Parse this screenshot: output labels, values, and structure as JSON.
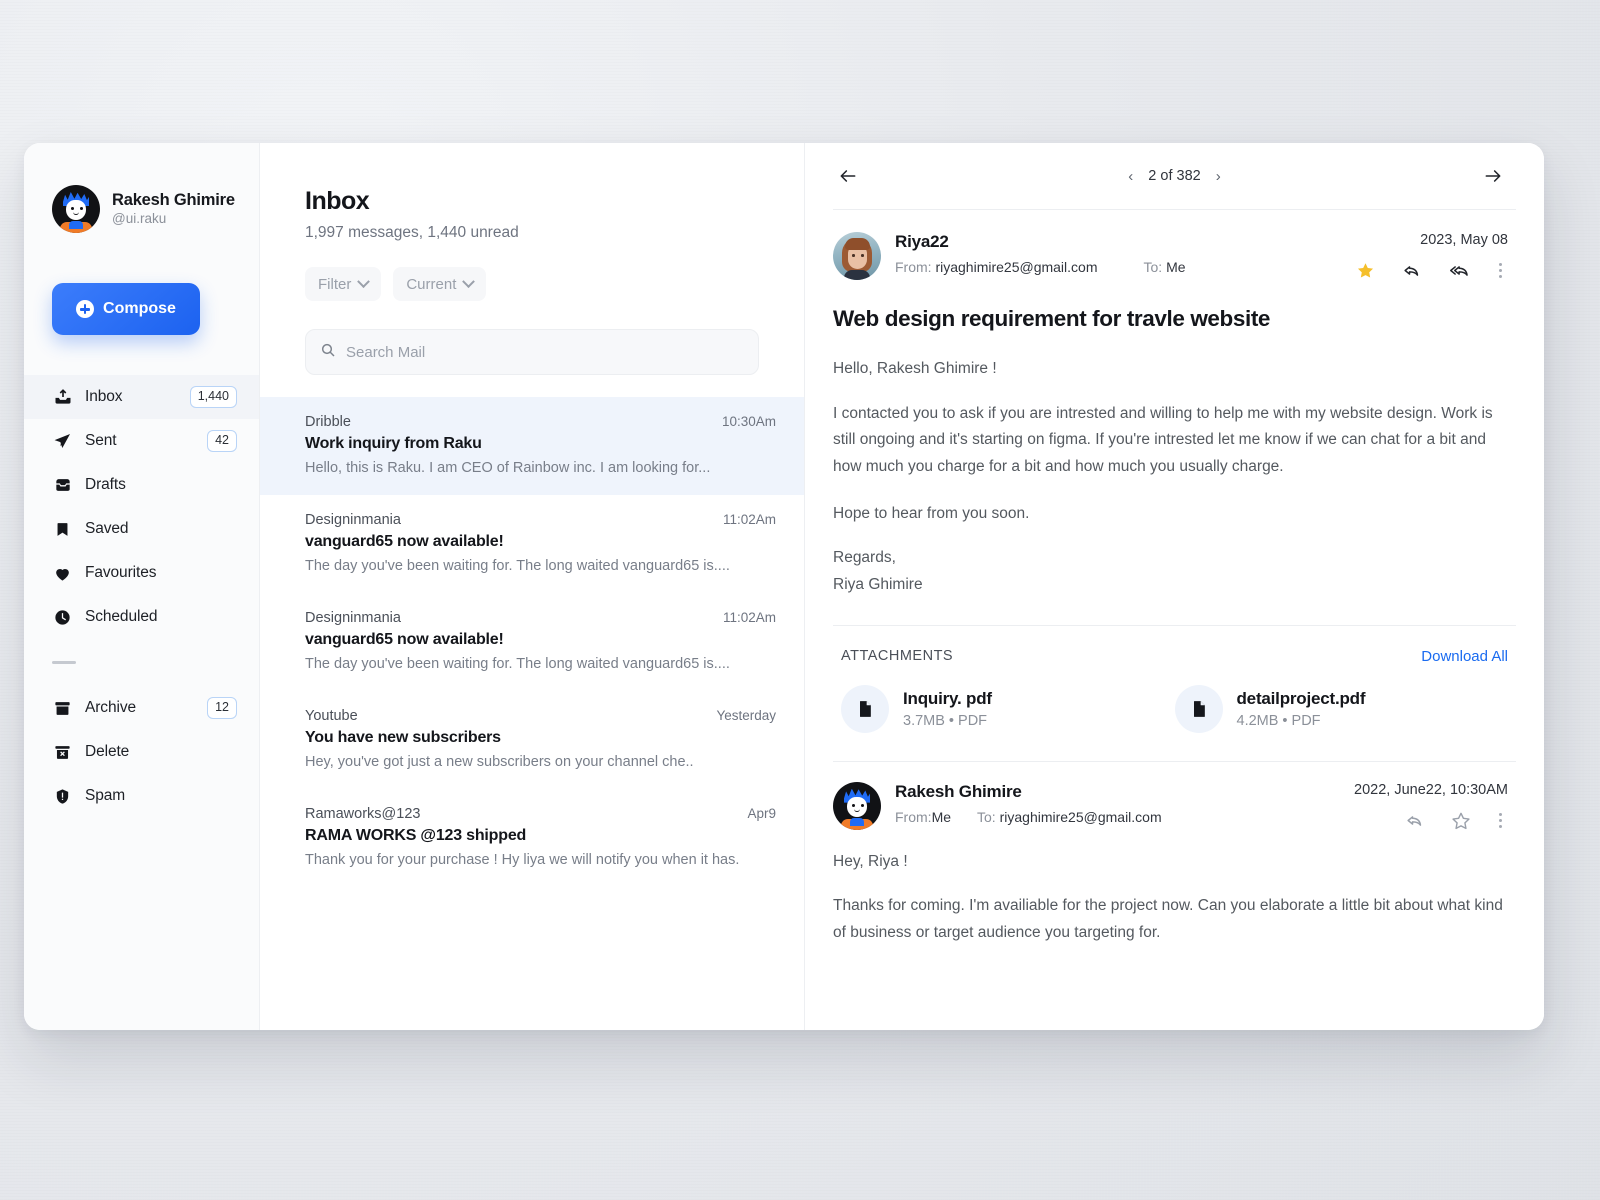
{
  "sidebar": {
    "profile": {
      "name": "Rakesh Ghimire",
      "handle": "@ui.raku"
    },
    "compose_label": "Compose",
    "items": [
      {
        "label": "Inbox",
        "badge": "1,440",
        "icon": "inbox-icon"
      },
      {
        "label": "Sent",
        "badge": "42",
        "icon": "send-icon"
      },
      {
        "label": "Drafts",
        "badge": "",
        "icon": "drafts-icon"
      },
      {
        "label": "Saved",
        "badge": "",
        "icon": "bookmark-icon"
      },
      {
        "label": "Favourites",
        "badge": "",
        "icon": "heart-icon"
      },
      {
        "label": "Scheduled",
        "badge": "",
        "icon": "clock-icon"
      }
    ],
    "items_secondary": [
      {
        "label": "Archive",
        "badge": "12",
        "icon": "archive-icon"
      },
      {
        "label": "Delete",
        "badge": "",
        "icon": "trash-icon"
      },
      {
        "label": "Spam",
        "badge": "",
        "icon": "spam-icon"
      }
    ]
  },
  "list": {
    "title": "Inbox",
    "subtitle": "1,997 messages, 1,440 unread",
    "filter_label": "Filter",
    "current_label": "Current",
    "search_placeholder": "Search Mail",
    "items": [
      {
        "sender": "Dribble",
        "time": "10:30Am",
        "subject": "Work inquiry from Raku",
        "preview": "Hello, this is Raku. I am CEO of Rainbow inc. I am looking for..."
      },
      {
        "sender": "Designinmania",
        "time": "11:02Am",
        "subject": "vanguard65 now available!",
        "preview": "The day you've been waiting for. The long waited vanguard65 is...."
      },
      {
        "sender": "Designinmania",
        "time": "11:02Am",
        "subject": "vanguard65 now available!",
        "preview": "The day you've been waiting for. The long waited vanguard65 is...."
      },
      {
        "sender": "Youtube",
        "time": "Yesterday",
        "subject": "You have new subscribers",
        "preview": "Hey, you've got just a new subscribers on your channel che.."
      },
      {
        "sender": "Ramaworks@123",
        "time": "Apr9",
        "subject": "RAMA WORKS @123 shipped",
        "preview": "Thank you for your purchase ! Hy liya we will notify you when it has."
      }
    ]
  },
  "reader": {
    "pager": "2 of 382",
    "message1": {
      "name": "Riya22",
      "from_label": "From:",
      "from_value": "riyaghimire25@gmail.com",
      "to_label": "To:",
      "to_value": "Me",
      "date": "2023, May 08",
      "subject": "Web design requirement for travle website",
      "greeting": "Hello, Rakesh Ghimire !",
      "paragraph": "I contacted you to ask if you are intrested and willing to help me with my website design. Work is still ongoing and it's starting on figma. If you're intrested let me know if we can chat for a bit and how much you charge for a bit and how much you usually charge.",
      "closing": "Hope to hear from you soon.",
      "signoff": "Regards,",
      "signature": "Riya Ghimire"
    },
    "attachments": {
      "label": "ATTACHMENTS",
      "download_all": "Download All",
      "files": [
        {
          "name": "Inquiry. pdf",
          "meta": "3.7MB • PDF"
        },
        {
          "name": "detailproject.pdf",
          "meta": "4.2MB • PDF"
        }
      ]
    },
    "message2": {
      "name": "Rakesh Ghimire",
      "from_label": "From:",
      "from_value": "Me",
      "to_label": "To:",
      "to_value": "riyaghimire25@gmail.com",
      "date": "2022, June22, 10:30AM",
      "greeting": "Hey, Riya !",
      "paragraph": "Thanks for coming. I'm availiable for the project now. Can you elaborate a little bit about what kind of business or target audience you targeting for."
    }
  },
  "colors": {
    "accent": "#1c62f0",
    "link": "#1a6bf0",
    "star": "#f5bf2b",
    "selected_row": "#eff4fc"
  }
}
